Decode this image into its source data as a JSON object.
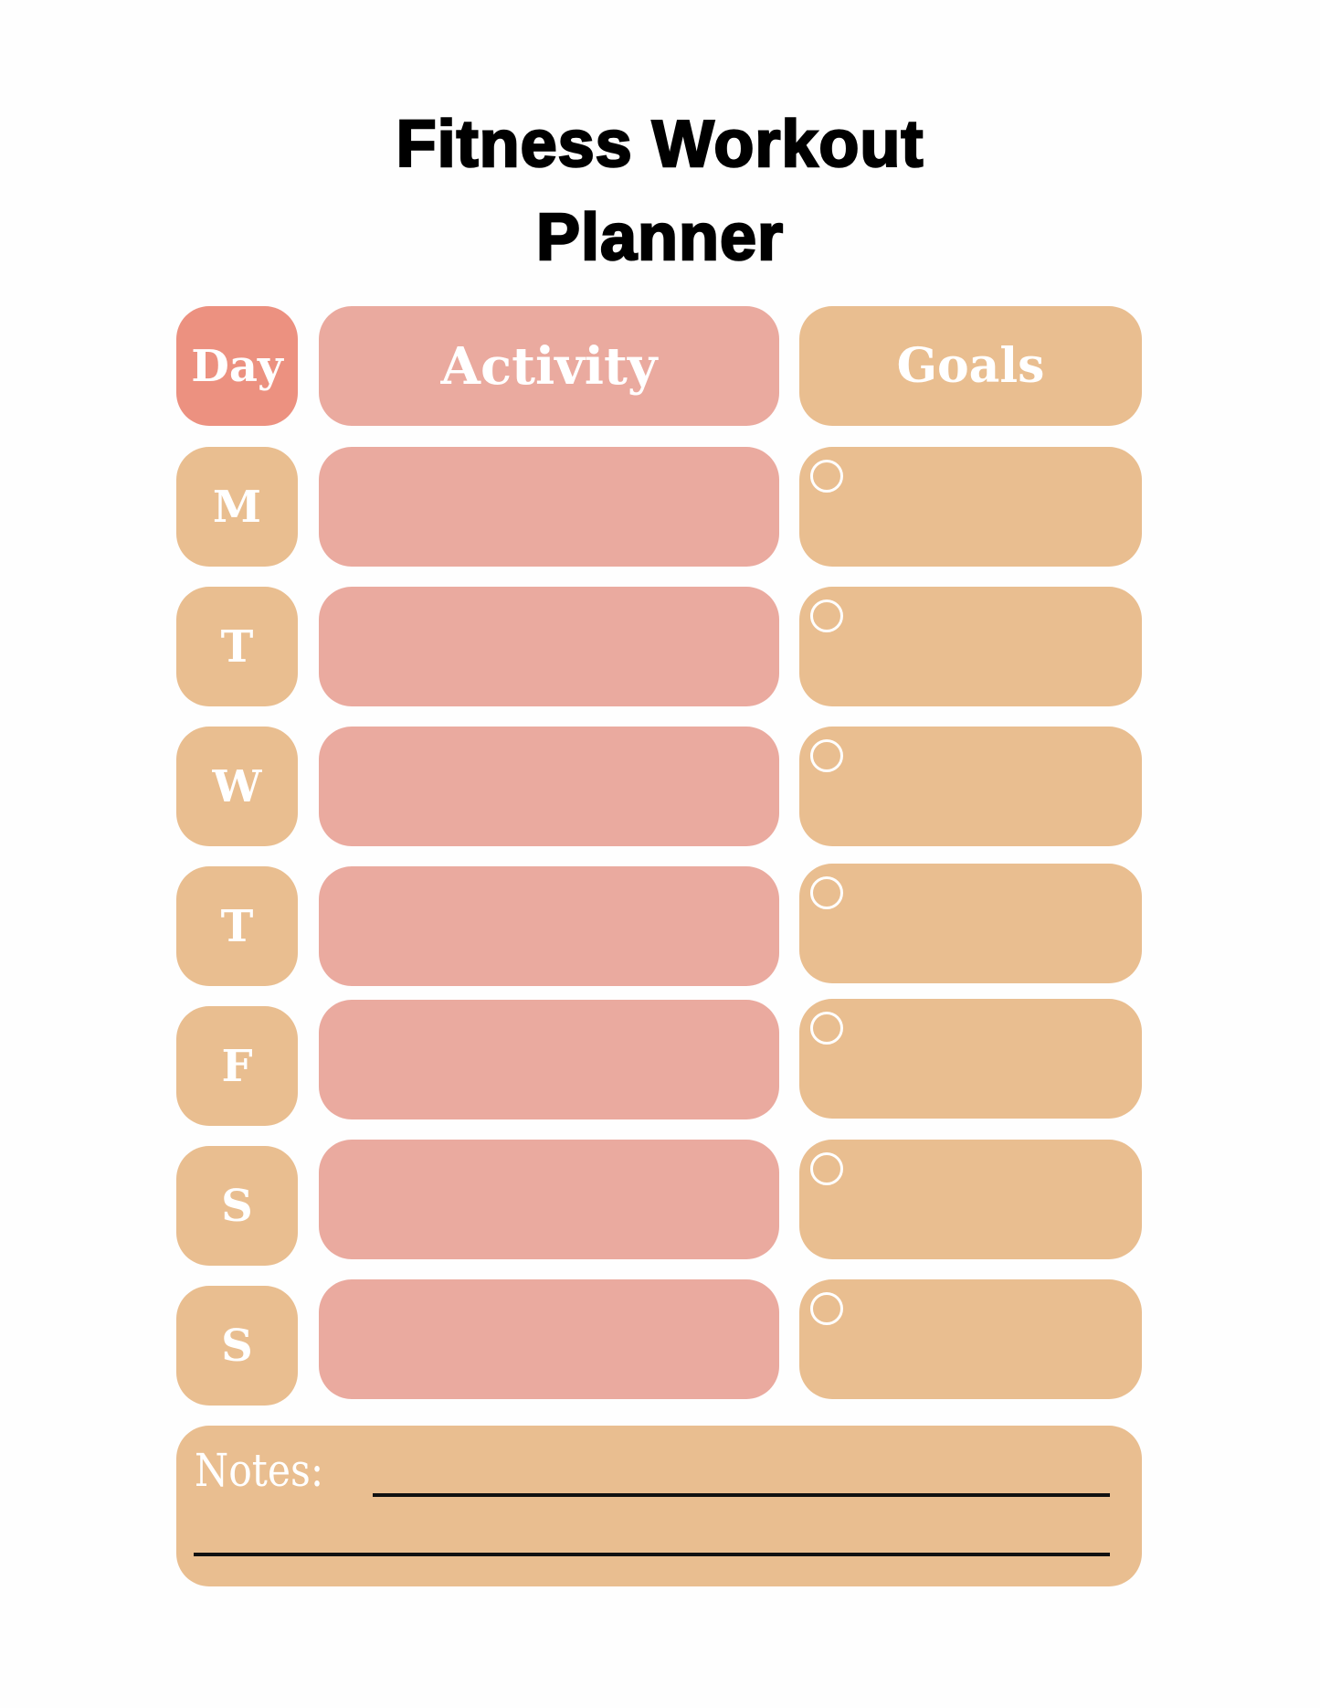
{
  "title": {
    "line1": "Fitness Workout",
    "line2": "Planner"
  },
  "headers": {
    "day": "Day",
    "activity": "Activity",
    "goals": "Goals"
  },
  "days": [
    {
      "label": "M",
      "activity": "",
      "goal": "",
      "goal_checked": false
    },
    {
      "label": "T",
      "activity": "",
      "goal": "",
      "goal_checked": false
    },
    {
      "label": "W",
      "activity": "",
      "goal": "",
      "goal_checked": false
    },
    {
      "label": "T",
      "activity": "",
      "goal": "",
      "goal_checked": false
    },
    {
      "label": "F",
      "activity": "",
      "goal": "",
      "goal_checked": false
    },
    {
      "label": "S",
      "activity": "",
      "goal": "",
      "goal_checked": false
    },
    {
      "label": "S",
      "activity": "",
      "goal": "",
      "goal_checked": false
    }
  ],
  "notes": {
    "label": "Notes:",
    "value": ""
  },
  "colors": {
    "day_header": "#EC9180",
    "activity": "#EAAA9F",
    "tan": "#E9BE90",
    "label_text": "#FFFFFF",
    "title_text": "#000000"
  }
}
